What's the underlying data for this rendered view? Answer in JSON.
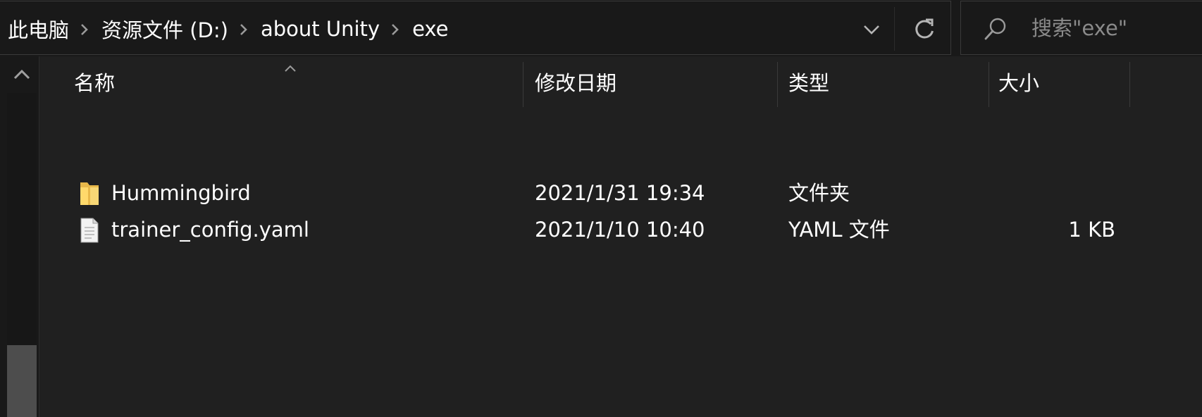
{
  "address_bar": {
    "breadcrumbs": [
      {
        "label": "此电脑"
      },
      {
        "label": "资源文件 (D:)"
      },
      {
        "label": "about Unity"
      },
      {
        "label": "exe"
      }
    ]
  },
  "search": {
    "placeholder": "搜索\"exe\""
  },
  "columns": {
    "name": "名称",
    "modified": "修改日期",
    "type": "类型",
    "size": "大小"
  },
  "files": [
    {
      "icon": "folder-icon",
      "name": "Hummingbird",
      "modified": "2021/1/31 19:34",
      "type": "文件夹",
      "size": ""
    },
    {
      "icon": "document-icon",
      "name": "trainer_config.yaml",
      "modified": "2021/1/10 10:40",
      "type": "YAML 文件",
      "size": "1 KB"
    }
  ],
  "colors": {
    "background": "#202020",
    "chrome": "#191919",
    "text": "#ffffff",
    "muted_text": "#8a8a8a",
    "folder": "#f8d775",
    "scroll_thumb": "#4d4d4d"
  }
}
